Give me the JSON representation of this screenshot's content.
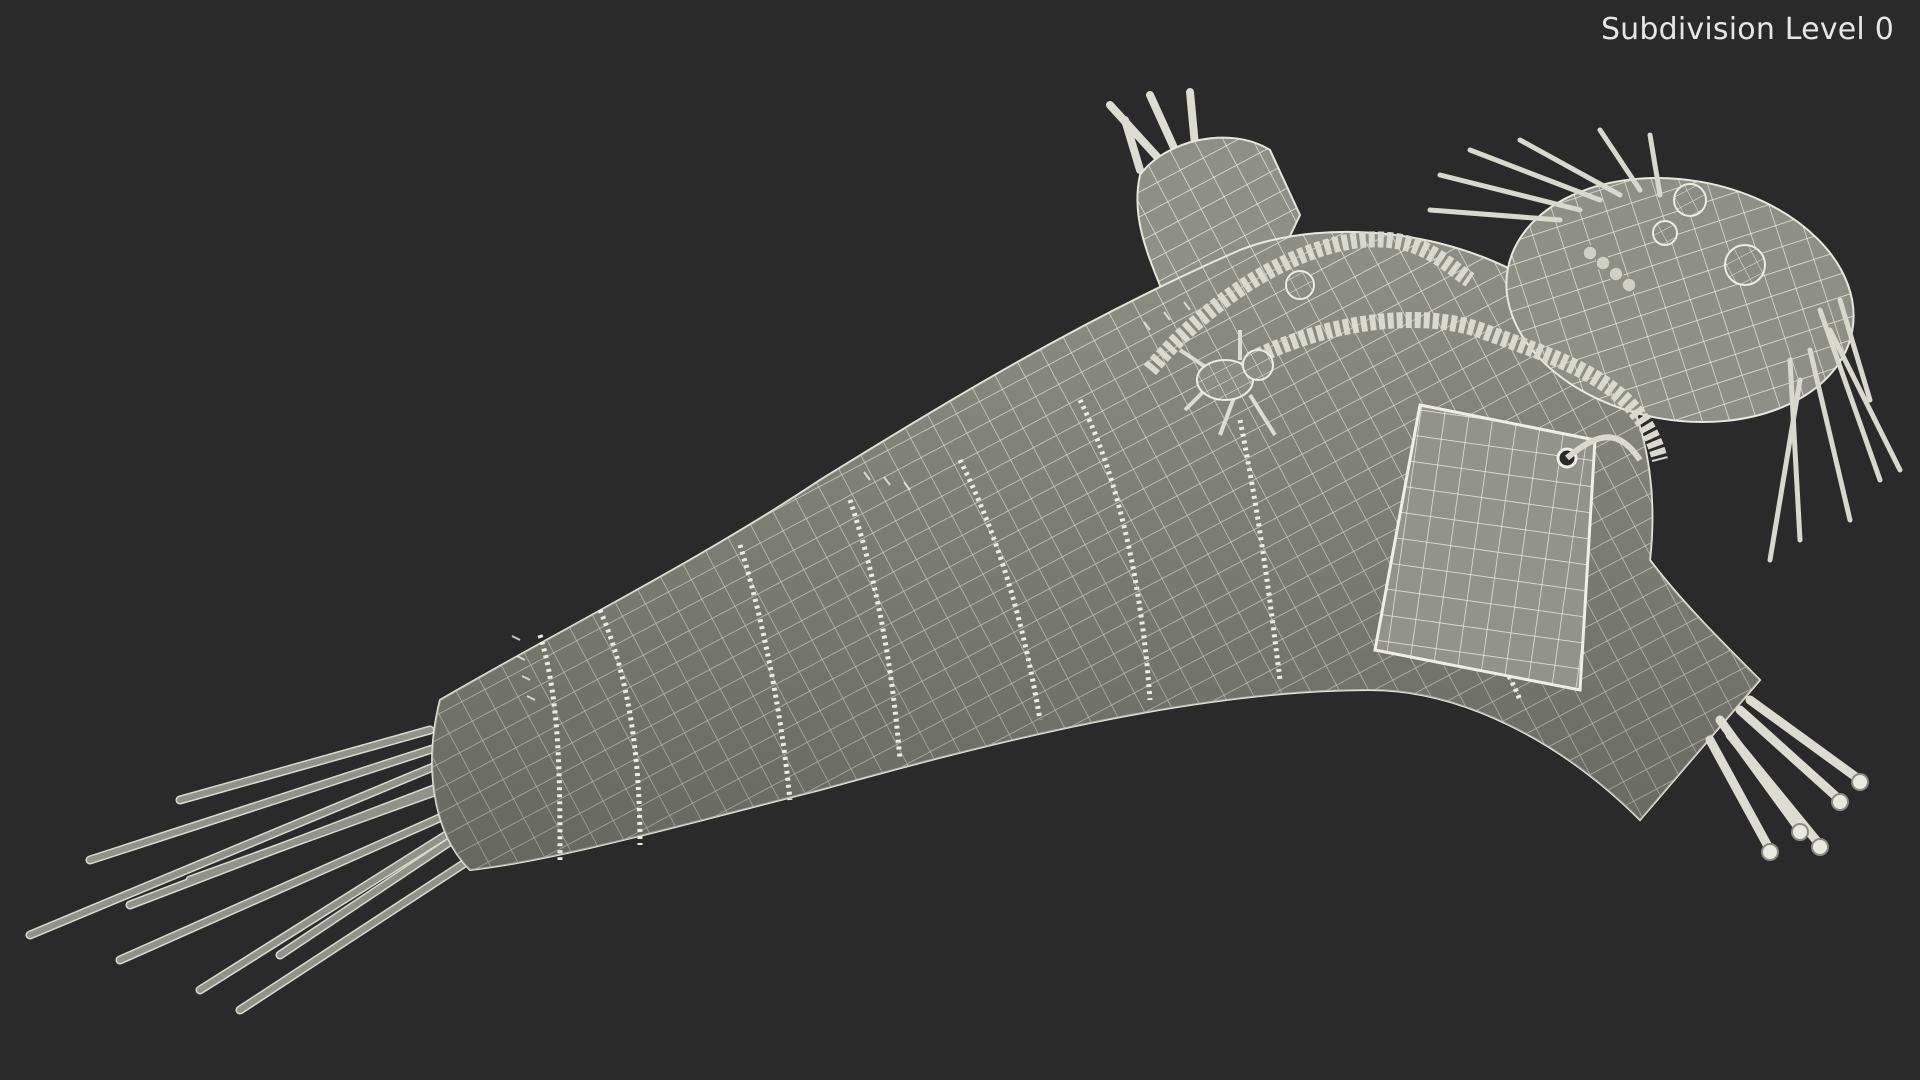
{
  "overlay": {
    "subdivision_label": "Subdivision Level 0"
  },
  "scene": {
    "subject": "voodoo-doll-wireframe",
    "background_color": "#2a2a2a",
    "mesh_color": "#8f9087",
    "wire_color": "#e9e9e0"
  }
}
